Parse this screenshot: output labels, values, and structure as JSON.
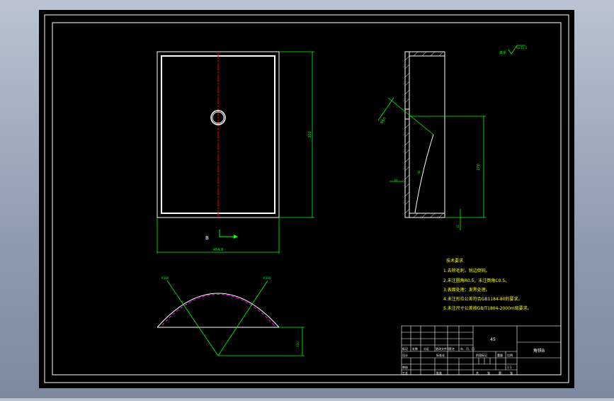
{
  "colors": {
    "background": "#000000",
    "desktop": "#a6b0c0",
    "frame": "#ffffff",
    "dimension": "#00ff00",
    "centerline": "#ff0000",
    "hidden_arc": "#ff00ff",
    "annotation": "#ffff00"
  },
  "surface_finish": {
    "label": "其余",
    "value": "Ra 12.5"
  },
  "dimensions": {
    "front_height": "300",
    "front_width": "454.8",
    "section_label": "B",
    "side_top": "R60",
    "side_angle": "R",
    "side_small": "30",
    "side_height": "270",
    "side_bottom": "12",
    "bottom_left_radius": "R300",
    "bottom_right_radius": "R300",
    "bottom_height": "110"
  },
  "technical_requirements": {
    "title": "技术要求",
    "items": [
      "1.去除毛刺，锐边倒钝。",
      "2.未注圆角R0.5，未注倒角C0.5。",
      "3.表面处理：发黑处理。",
      "4.未注形位公差符合GB1184-80的要求。",
      "5.未注尺寸公差按GB/T1804-2000m级要求。"
    ]
  },
  "title_block": {
    "material": "45",
    "part_name": "角铁B",
    "scale": "1:1",
    "row_labels": [
      "标记",
      "处数",
      "分区",
      "更改文件号",
      "签名",
      "年、月、日"
    ],
    "left_labels": [
      "设计",
      "审核",
      "工艺"
    ],
    "mid_labels": [
      "标准化",
      "批准"
    ],
    "stage_label": "阶段标记",
    "weight_label": "重量",
    "scale_label": "比例",
    "sheet_labels": [
      "共",
      "张",
      "第",
      "张"
    ]
  }
}
